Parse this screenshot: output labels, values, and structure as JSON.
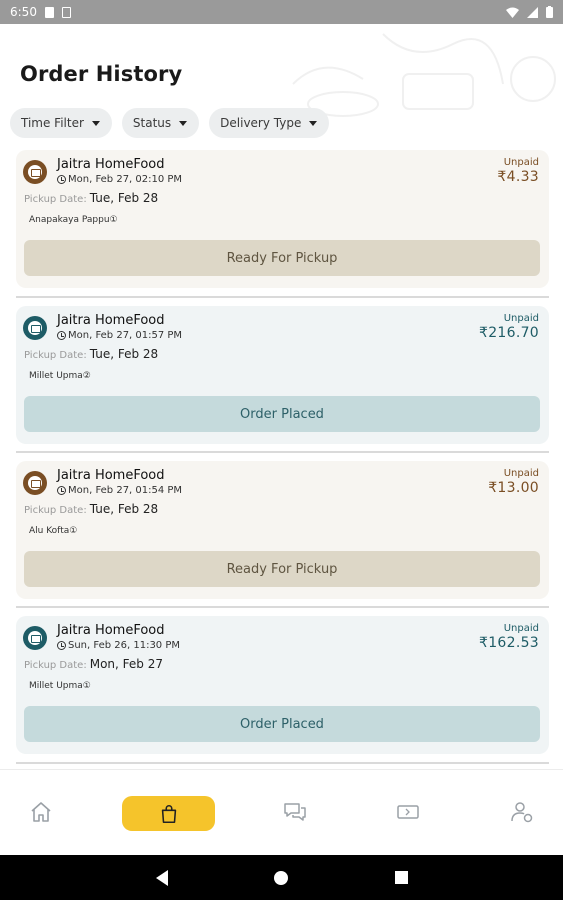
{
  "status_bar": {
    "time": "6:50"
  },
  "page": {
    "title": "Order History"
  },
  "filters": [
    {
      "label": "Time Filter"
    },
    {
      "label": "Status"
    },
    {
      "label": "Delivery Type"
    }
  ],
  "orders": [
    {
      "shop": "Jaitra HomeFood",
      "datetime": "Mon, Feb 27, 02:10 PM",
      "payment": "Unpaid",
      "amount": "₹4.33",
      "pickup_label": "Pickup Date:",
      "pickup_date": "Tue, Feb 28",
      "item": "Anapakaya Pappu",
      "item_qty": "①",
      "status": "Ready For Pickup",
      "kind": "ready"
    },
    {
      "shop": "Jaitra HomeFood",
      "datetime": "Mon, Feb 27, 01:57 PM",
      "payment": "Unpaid",
      "amount": "₹216.70",
      "pickup_label": "Pickup Date:",
      "pickup_date": "Tue, Feb 28",
      "item": "Millet Upma",
      "item_qty": "②",
      "status": "Order Placed",
      "kind": "placed"
    },
    {
      "shop": "Jaitra HomeFood",
      "datetime": "Mon, Feb 27, 01:54 PM",
      "payment": "Unpaid",
      "amount": "₹13.00",
      "pickup_label": "Pickup Date:",
      "pickup_date": "Tue, Feb 28",
      "item": "Alu Kofta",
      "item_qty": "①",
      "status": "Ready For Pickup",
      "kind": "ready"
    },
    {
      "shop": "Jaitra HomeFood",
      "datetime": "Sun, Feb 26, 11:30 PM",
      "payment": "Unpaid",
      "amount": "₹162.53",
      "pickup_label": "Pickup Date:",
      "pickup_date": "Mon, Feb 27",
      "item": "Millet Upma",
      "item_qty": "①",
      "status": "Order Placed",
      "kind": "placed"
    }
  ],
  "bottom_nav": [
    {
      "icon": "home-icon"
    },
    {
      "icon": "shopping-bag-icon",
      "active": true
    },
    {
      "icon": "chat-icon"
    },
    {
      "icon": "ticket-icon"
    },
    {
      "icon": "profile-settings-icon"
    }
  ],
  "colors": {
    "accent": "#f5c42b",
    "ready_brown": "#7a4e24",
    "placed_teal": "#1e5c66",
    "ready_button": "#ddd7c7",
    "placed_button": "#c5dadc"
  }
}
